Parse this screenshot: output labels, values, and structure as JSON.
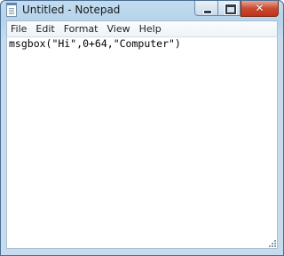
{
  "window": {
    "title": "Untitled - Notepad",
    "close_glyph": "✕"
  },
  "menu": {
    "items": [
      {
        "label": "File"
      },
      {
        "label": "Edit"
      },
      {
        "label": "Format"
      },
      {
        "label": "View"
      },
      {
        "label": "Help"
      }
    ]
  },
  "editor": {
    "content": "msgbox(\"Hi\",0+64,\"Computer\")"
  },
  "colors": {
    "frame": "#c2dcef",
    "close_button": "#c94b31",
    "editor_background": "#ffffff"
  }
}
